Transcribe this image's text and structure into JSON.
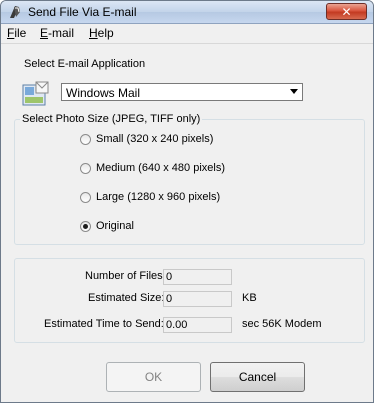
{
  "window": {
    "title": "Send File Via E-mail",
    "close_glyph": "✕",
    "icon": "send-mail-icon"
  },
  "menu": [
    {
      "label": "File",
      "accel": "F",
      "rest": "ile"
    },
    {
      "label": "E-mail",
      "accel": "E",
      "rest": "-mail"
    },
    {
      "label": "Help",
      "accel": "H",
      "rest": "elp"
    }
  ],
  "email_app": {
    "label": "Select E-mail Application",
    "selected": "Windows Mail",
    "icon": "mail-app-icon"
  },
  "photo_size": {
    "label": "Select Photo Size (JPEG, TIFF only)",
    "options": [
      {
        "label": "Small (320 x 240 pixels)",
        "checked": false
      },
      {
        "label": "Medium (640 x 480 pixels)",
        "checked": false
      },
      {
        "label": "Large (1280 x 960 pixels)",
        "checked": false
      },
      {
        "label": "Original",
        "checked": true
      }
    ]
  },
  "stats": {
    "num_files_label": "Number of Files:",
    "num_files_value": "0",
    "est_size_label": "Estimated Size:",
    "est_size_value": "0",
    "est_size_unit": "KB",
    "est_time_label": "Estimated Time to Send:",
    "est_time_value": "0.00",
    "est_time_unit": "sec 56K Modem"
  },
  "buttons": {
    "ok": "OK",
    "cancel": "Cancel"
  },
  "colors": {
    "titlebar": "#c3d4ea",
    "close": "#c43b22",
    "group_border": "#d5dfe5"
  }
}
